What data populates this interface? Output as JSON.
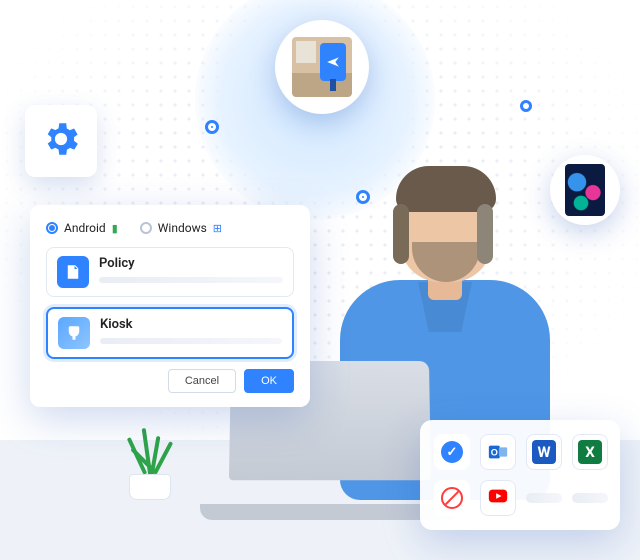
{
  "dialog": {
    "os_options": {
      "android": "Android",
      "windows": "Windows"
    },
    "options": {
      "policy": "Policy",
      "kiosk": "Kiosk"
    },
    "buttons": {
      "cancel": "Cancel",
      "ok": "OK"
    }
  },
  "apps": {
    "allowed_status_icon": "check",
    "blocked_status_icon": "blocked",
    "row1": {
      "outlook_letter": "O",
      "word_letter": "W",
      "excel_letter": "X"
    },
    "row2": {
      "youtube": "youtube"
    }
  },
  "colors": {
    "accent": "#2f83ff"
  }
}
